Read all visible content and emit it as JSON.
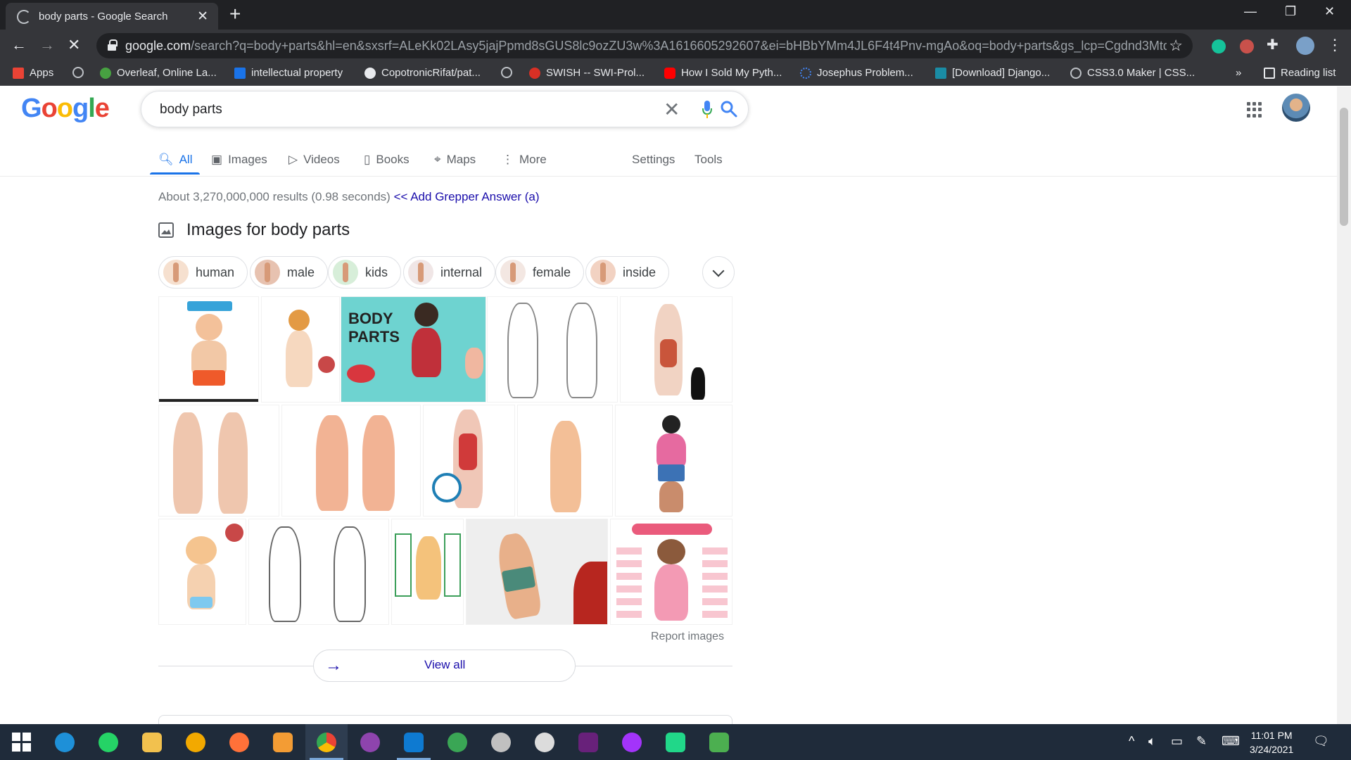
{
  "browser": {
    "tab_title": "body parts - Google Search",
    "tab_close": "✕",
    "new_tab": "+",
    "url_host": "google.com",
    "url_path": "/search?q=body+parts&hl=en&sxsrf=ALeKk02LAsy5jajPpmd8sGUS8lc9ozZU3w%3A1616605292607&ei=bHBbYMm4JL6F4t4Pnv-mgAo&oq=body+parts&gs_lcp=Cgdnd3Mtd2l6...",
    "bookmarks": [
      {
        "label": "Apps",
        "color": "#ea4335"
      },
      {
        "label": "",
        "color": "#bdc1c6"
      },
      {
        "label": "Overleaf, Online La...",
        "color": "#47a141"
      },
      {
        "label": "intellectual property",
        "color": "#1a73e8"
      },
      {
        "label": "CopotronicRifat/pat...",
        "color": "#e8eaed"
      },
      {
        "label": "",
        "color": "#bdc1c6"
      },
      {
        "label": "SWISH -- SWI-Prol...",
        "color": "#d93025"
      },
      {
        "label": "How I Sold My Pyth...",
        "color": "#ff0000"
      },
      {
        "label": "Josephus Problem...",
        "color": "#4285f4"
      },
      {
        "label": "[Download] Django...",
        "color": "#1a8ca5"
      },
      {
        "label": "CSS3.0 Maker | CSS...",
        "color": "#bdc1c6"
      }
    ],
    "bookmarks_overflow": "»",
    "reading_list": "Reading list"
  },
  "google": {
    "logo_letters": [
      {
        "ch": "G",
        "color": "#4285f4"
      },
      {
        "ch": "o",
        "color": "#ea4335"
      },
      {
        "ch": "o",
        "color": "#fbbc05"
      },
      {
        "ch": "g",
        "color": "#4285f4"
      },
      {
        "ch": "l",
        "color": "#34a853"
      },
      {
        "ch": "e",
        "color": "#ea4335"
      }
    ],
    "query": "body parts",
    "tabs": [
      "All",
      "Images",
      "Videos",
      "Books",
      "Maps",
      "More"
    ],
    "settings": "Settings",
    "tools": "Tools",
    "stats": "About 3,270,000,000 results (0.98 seconds)",
    "grepper_link": "<< Add Grepper Answer (a)",
    "images_heading": "Images for body parts",
    "chips": [
      "human",
      "male",
      "kids",
      "internal",
      "female",
      "inside"
    ],
    "report_images": "Report images",
    "view_all": "View all"
  },
  "taskbar": {
    "time": "11:01 PM",
    "date": "3/24/2021"
  }
}
